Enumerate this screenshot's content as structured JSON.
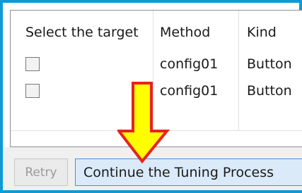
{
  "table": {
    "headers": [
      "Select the target",
      "Method",
      "Kind"
    ],
    "rows": [
      {
        "selected": false,
        "method": "config01",
        "kind": "Button"
      },
      {
        "selected": false,
        "method": "config01",
        "kind": "Button"
      }
    ]
  },
  "buttons": {
    "retry_label": "Retry",
    "continue_label": "Continue the Tuning Process"
  },
  "annotation": {
    "icon": "down-arrow-icon",
    "fill_color": "#ffff00",
    "stroke_color": "#e8231f"
  },
  "colors": {
    "frame_border": "#0f9ad6",
    "continue_button_bg": "#dbeaf9",
    "continue_button_border": "#4a90d9"
  }
}
